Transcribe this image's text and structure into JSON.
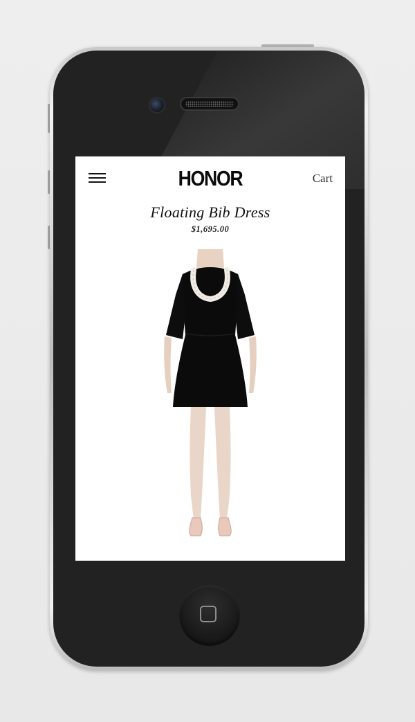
{
  "app": {
    "brand": "HONOR",
    "cart_label": "Cart"
  },
  "product": {
    "title": "Floating Bib Dress",
    "price": "$1,695.00"
  },
  "icons": {
    "menu": "hamburger-menu-icon",
    "home": "home-button-square-icon"
  },
  "colors": {
    "text": "#111111",
    "screen_bg": "#ffffff",
    "phone_body": "#222222"
  }
}
